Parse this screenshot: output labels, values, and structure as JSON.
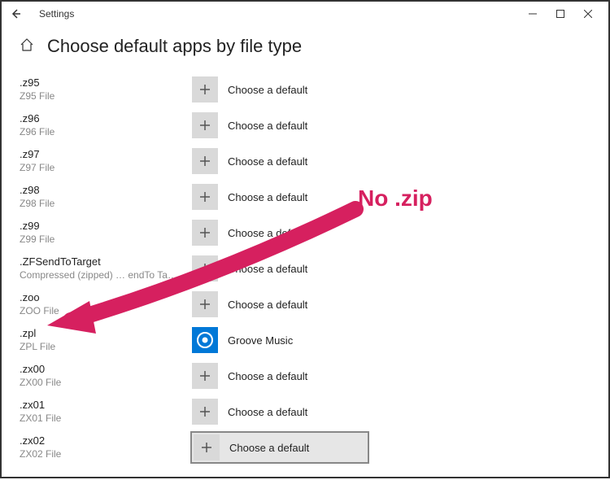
{
  "window": {
    "title": "Settings"
  },
  "page": {
    "heading": "Choose default apps by file type"
  },
  "default_label": "Choose a default",
  "rows": [
    {
      "ext": ".z95",
      "desc": "Z95 File",
      "app_icon": "plus",
      "app_label": "Choose a default",
      "selected": false
    },
    {
      "ext": ".z96",
      "desc": "Z96 File",
      "app_icon": "plus",
      "app_label": "Choose a default",
      "selected": false
    },
    {
      "ext": ".z97",
      "desc": "Z97 File",
      "app_icon": "plus",
      "app_label": "Choose a default",
      "selected": false
    },
    {
      "ext": ".z98",
      "desc": "Z98 File",
      "app_icon": "plus",
      "app_label": "Choose a default",
      "selected": false
    },
    {
      "ext": ".z99",
      "desc": "Z99 File",
      "app_icon": "plus",
      "app_label": "Choose a default",
      "selected": false
    },
    {
      "ext": ".ZFSendToTarget",
      "desc": "Compressed (zipped) … endTo Ta…",
      "app_icon": "plus",
      "app_label": "Choose a default",
      "selected": false
    },
    {
      "ext": ".zoo",
      "desc": "ZOO File",
      "app_icon": "plus",
      "app_label": "Choose a default",
      "selected": false
    },
    {
      "ext": ".zpl",
      "desc": "ZPL File",
      "app_icon": "groove",
      "app_label": "Groove Music",
      "selected": false
    },
    {
      "ext": ".zx00",
      "desc": "ZX00 File",
      "app_icon": "plus",
      "app_label": "Choose a default",
      "selected": false
    },
    {
      "ext": ".zx01",
      "desc": "ZX01 File",
      "app_icon": "plus",
      "app_label": "Choose a default",
      "selected": false
    },
    {
      "ext": ".zx02",
      "desc": "ZX02 File",
      "app_icon": "plus",
      "app_label": "Choose a default",
      "selected": true
    }
  ],
  "annotation": {
    "text": "No .zip",
    "color": "#d6205f"
  }
}
